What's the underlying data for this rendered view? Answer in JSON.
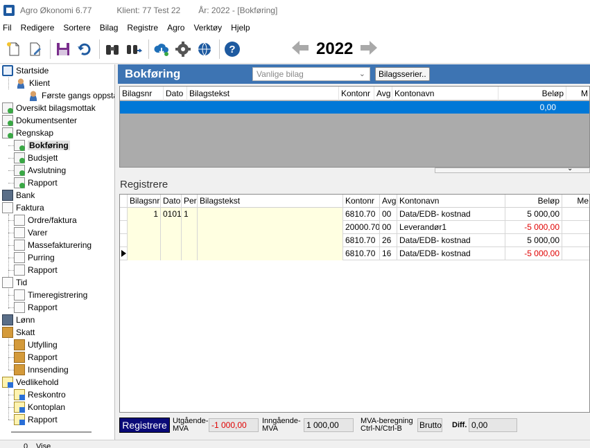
{
  "titlebar": {
    "app": "Agro Økonomi 6.77",
    "client": "Klient:  77  Test 22",
    "year": "År: 2022 - [Bokføring]"
  },
  "menu": [
    "Fil",
    "Redigere",
    "Sortere",
    "Bilag",
    "Registre",
    "Agro",
    "Verktøy",
    "Hjelp"
  ],
  "toolbar": {
    "icons": [
      "new-document-icon",
      "edit-document-icon",
      "save-icon",
      "undo-icon",
      "binoculars-icon",
      "binoculars-forward-icon",
      "cloud-download-icon",
      "gear-icon",
      "globe-icon",
      "help-icon"
    ],
    "year": "2022"
  },
  "sidebar": {
    "items": [
      {
        "label": "Startside"
      },
      {
        "label": "Klient"
      },
      {
        "label": "Første gangs oppstart"
      },
      {
        "label": "Oversikt bilagsmottak"
      },
      {
        "label": "Dokumentsenter"
      },
      {
        "label": "Regnskap"
      },
      {
        "label": "Bokføring"
      },
      {
        "label": "Budsjett"
      },
      {
        "label": "Avslutning"
      },
      {
        "label": "Rapport"
      },
      {
        "label": "Bank"
      },
      {
        "label": "Faktura"
      },
      {
        "label": "Ordre/faktura"
      },
      {
        "label": "Varer"
      },
      {
        "label": "Massefakturering"
      },
      {
        "label": "Purring"
      },
      {
        "label": "Rapport"
      },
      {
        "label": "Tid"
      },
      {
        "label": "Timeregistrering"
      },
      {
        "label": "Rapport"
      },
      {
        "label": "Lønn"
      },
      {
        "label": "Skatt"
      },
      {
        "label": "Utfylling"
      },
      {
        "label": "Rapport"
      },
      {
        "label": "Innsending"
      },
      {
        "label": "Vedlikehold"
      },
      {
        "label": "Reskontro"
      },
      {
        "label": "Kontoplan"
      },
      {
        "label": "Rapport"
      }
    ]
  },
  "header": {
    "title": "Bokføring",
    "select_value": "Vanlige bilag",
    "series_button": "Bilagsserier.."
  },
  "top_grid": {
    "columns": [
      "Bilagsnr",
      "Dato",
      "Bilagstekst",
      "Kontonr",
      "Avg",
      "Kontonavn",
      "Beløp",
      "M"
    ],
    "selected_sum": "0,00"
  },
  "section_label": "Registrere",
  "register_grid": {
    "columns": [
      "Bilagsnr",
      "Dato",
      "Per",
      "Bilagstekst",
      "Kontonr",
      "Avg",
      "Kontonavn",
      "Beløp",
      "Me"
    ],
    "rows": [
      {
        "bilagsnr": "1",
        "dato": "0101",
        "per": "1",
        "tekst": "",
        "kontonr": "6810.70",
        "avg": "00",
        "kontonavn": "Data/EDB- kostnad",
        "belop": "5 000,00",
        "negative": false
      },
      {
        "bilagsnr": "",
        "dato": "",
        "per": "",
        "tekst": "",
        "kontonr": "20000.70",
        "avg": "00",
        "kontonavn": "Leverandør1",
        "belop": "-5 000,00",
        "negative": true
      },
      {
        "bilagsnr": "",
        "dato": "",
        "per": "",
        "tekst": "",
        "kontonr": "6810.70",
        "avg": "26",
        "kontonavn": "Data/EDB- kostnad",
        "belop": "5 000,00",
        "negative": false
      },
      {
        "bilagsnr": "",
        "dato": "",
        "per": "",
        "tekst": "",
        "kontonr": "6810.70",
        "avg": "16",
        "kontonavn": "Data/EDB- kostnad",
        "belop": "-5 000,00",
        "negative": true
      }
    ]
  },
  "footer": {
    "register_button": "Registrere",
    "utgaende_label": "Utgående-MVA",
    "utgaende_value": "-1 000,00",
    "inngaende_label": "Inngående-MVA",
    "inngaende_value": "1 000,00",
    "mva_label": "MVA-beregning Ctrl-N/Ctrl-B",
    "mva_value": "Brutto",
    "diff_label": "Diff.",
    "diff_value": "0,00"
  },
  "statusbar": {
    "count": "0",
    "text": "Vise"
  },
  "colors": {
    "header_band": "#3d74b3",
    "selection": "#0078d7",
    "register_button": "#0a0a78",
    "negative": "#e00000",
    "input_yellow": "#ffffe1"
  }
}
